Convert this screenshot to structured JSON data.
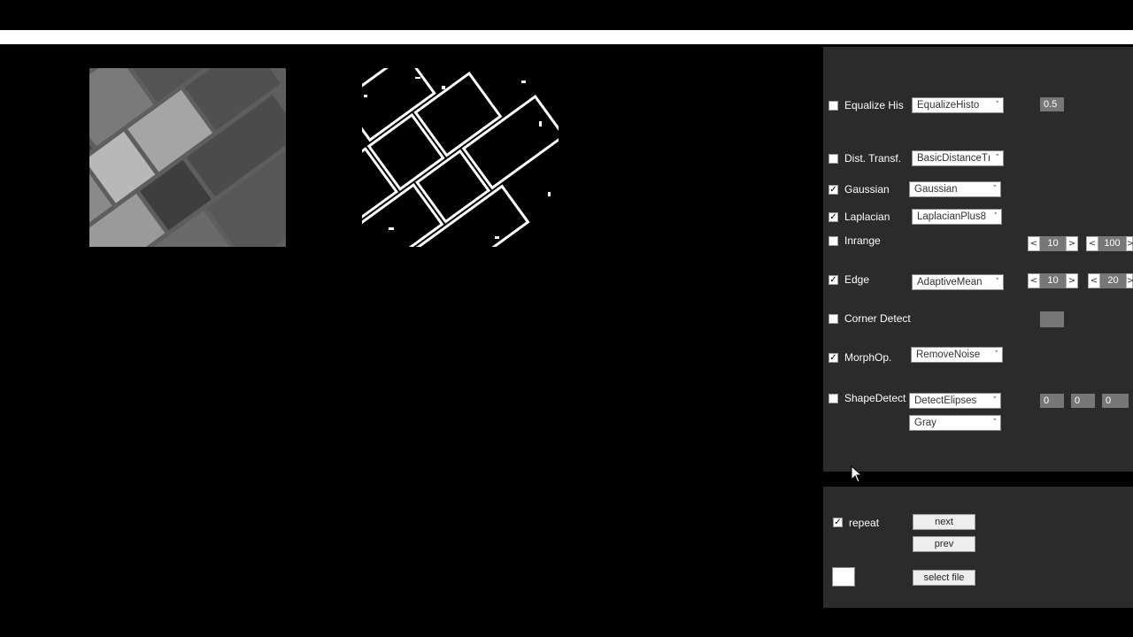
{
  "controls": [
    {
      "id": "equalize",
      "label": "Equalize His",
      "checked": false,
      "combo": "EqualizeHisto",
      "value": "0.5"
    },
    {
      "id": "dist",
      "label": "Dist. Transf.",
      "checked": false,
      "combo": "BasicDistanceTı"
    },
    {
      "id": "gaussian",
      "label": "Gaussian",
      "checked": true,
      "combo": "Gaussian"
    },
    {
      "id": "laplacian",
      "label": "Laplacian",
      "checked": true,
      "combo": "LaplacianPlus8"
    },
    {
      "id": "inrange",
      "label": "Inrange",
      "checked": false,
      "spin1": "10",
      "spin2": "100"
    },
    {
      "id": "edge",
      "label": "Edge",
      "checked": true,
      "combo": "AdaptiveMean",
      "spin1": "10",
      "spin2": "20"
    },
    {
      "id": "corner",
      "label": "Corner Detect",
      "checked": false
    },
    {
      "id": "morph",
      "label": "MorphOp.",
      "checked": true,
      "combo": "RemoveNoise"
    },
    {
      "id": "shape",
      "label": "ShapeDetect",
      "checked": false,
      "combo": "DetectElipses",
      "combo2": "Gray",
      "v1": "0",
      "v2": "0",
      "v3": "0"
    }
  ],
  "spin": {
    "left": "<",
    "right": ">"
  },
  "check_glyph": "✓",
  "combo_arrow": "˅",
  "bottom": {
    "repeat_label": "repeat",
    "repeat_checked": true,
    "next": "next",
    "prev": "prev",
    "select_file": "select file"
  },
  "icons": {
    "cursor": "mouse-pointer-icon"
  }
}
